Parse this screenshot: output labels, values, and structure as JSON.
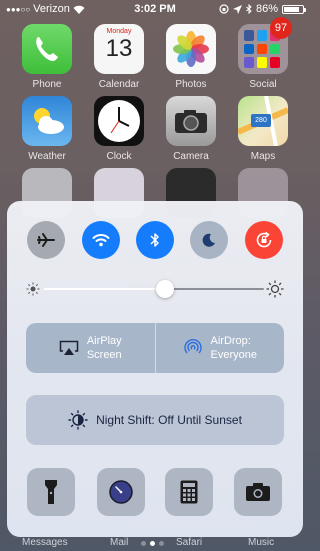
{
  "status_bar": {
    "carrier": "Verizon",
    "time": "3:02 PM",
    "battery_percent": "86%",
    "battery_level": 0.86
  },
  "home_apps": [
    {
      "label": "Phone",
      "icon": "phone-icon"
    },
    {
      "label": "Calendar",
      "icon": "calendar-icon",
      "weekday": "Monday",
      "day": "13"
    },
    {
      "label": "Photos",
      "icon": "photos-icon"
    },
    {
      "label": "Social",
      "icon": "folder-icon",
      "badge": "97"
    },
    {
      "label": "Weather",
      "icon": "weather-icon"
    },
    {
      "label": "Clock",
      "icon": "clock-icon"
    },
    {
      "label": "Camera",
      "icon": "camera-icon"
    },
    {
      "label": "Maps",
      "icon": "maps-icon",
      "sign": "280"
    }
  ],
  "dock": {
    "labels": [
      "Messages",
      "Mail",
      "Safari",
      "Music"
    ]
  },
  "page_dots": {
    "count": 3,
    "active": 1
  },
  "control_center": {
    "toggles": [
      {
        "name": "airplane-mode",
        "icon": "airplane-icon",
        "on": false
      },
      {
        "name": "wifi",
        "icon": "wifi-icon",
        "on": true
      },
      {
        "name": "bluetooth",
        "icon": "bluetooth-icon",
        "on": true
      },
      {
        "name": "do-not-disturb",
        "icon": "moon-icon",
        "on": false
      },
      {
        "name": "rotation-lock",
        "icon": "rotation-lock-icon",
        "on": true
      }
    ],
    "brightness": {
      "level": 0.55
    },
    "airplay": {
      "line1": "AirPlay",
      "line2": "Screen"
    },
    "airdrop": {
      "line1": "AirDrop:",
      "line2": "Everyone"
    },
    "night_shift": {
      "label": "Night Shift: Off Until Sunset"
    },
    "shortcuts": [
      {
        "name": "flashlight",
        "icon": "flashlight-icon"
      },
      {
        "name": "timer",
        "icon": "timer-icon"
      },
      {
        "name": "calculator",
        "icon": "calculator-icon"
      },
      {
        "name": "camera",
        "icon": "camera-icon"
      }
    ],
    "colors": {
      "blue": "#157dfc",
      "red": "#fa4436",
      "gray": "#a4a9b2"
    }
  }
}
